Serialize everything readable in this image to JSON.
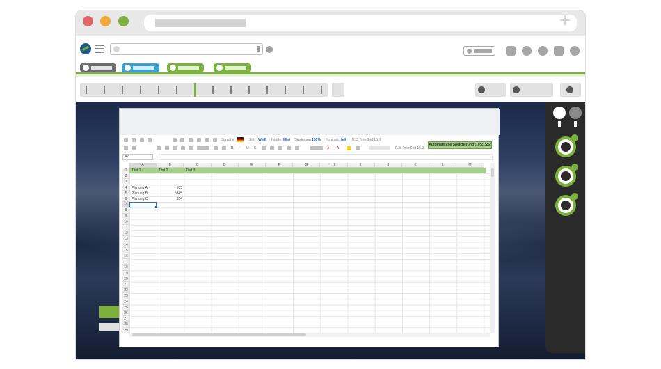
{
  "toolbar": {
    "sprache_label": "Sprache",
    "stil_label": "Stil:",
    "stil_value": "Weiß",
    "groesse_label": "Größe:",
    "groesse_value": "Mini",
    "skalierung_label": "Skalierung:",
    "skalierung_value": "100%",
    "kontrast_label": "Kontrast:",
    "kontrast_value": "Hell",
    "font1": "EJS TreeGrid 15.0",
    "font2": "EJS TreeGrid 15.0",
    "save_button": "Automatische Speicherung (10:21:26)"
  },
  "namebox": "A7",
  "columns": [
    "A",
    "B",
    "C",
    "D",
    "E",
    "F",
    "G",
    "H",
    "I",
    "J",
    "K",
    "L",
    "M"
  ],
  "rows": [
    "1",
    "2",
    "3",
    "4",
    "5",
    "6",
    "7",
    "8",
    "9",
    "10",
    "11",
    "12",
    "13",
    "14",
    "15",
    "16",
    "17",
    "18",
    "19",
    "20",
    "21",
    "22",
    "23",
    "24",
    "25",
    "26",
    "27",
    "28",
    "29"
  ],
  "cells": {
    "titel1": "Titel 1",
    "titel2": "Titel 2",
    "titel3": "Titel 3",
    "planA": "Planung A",
    "planB": "Planung B",
    "planC": "Planung C",
    "valA": "555",
    "valB": "5345",
    "valC": "354"
  },
  "colors": {
    "accent": "#7bb13c",
    "header_row": "#a8d08d",
    "selection": "#2b6cc4"
  }
}
